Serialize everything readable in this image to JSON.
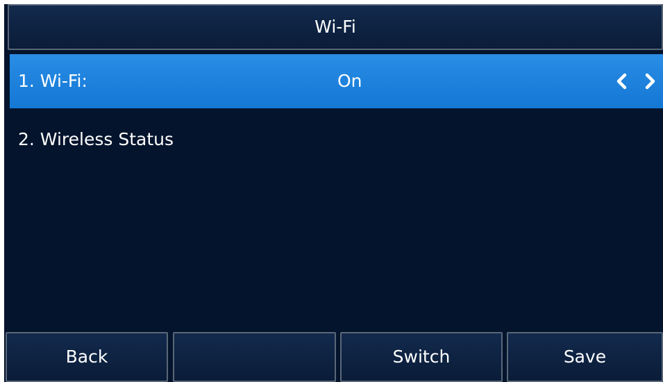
{
  "title": "Wi-Fi",
  "menu": [
    {
      "label": "1. Wi-Fi:",
      "value": "On",
      "selected": true,
      "left_arrow": "chevron-left-icon",
      "right_arrow": "chevron-right-icon"
    },
    {
      "label": "2. Wireless Status",
      "selected": false
    }
  ],
  "softkeys": [
    "Back",
    "",
    "Switch",
    "Save"
  ],
  "colors": {
    "background": "#04142c",
    "selected": "#1a82dd",
    "border": "#5a6778",
    "text": "#ffffff"
  }
}
